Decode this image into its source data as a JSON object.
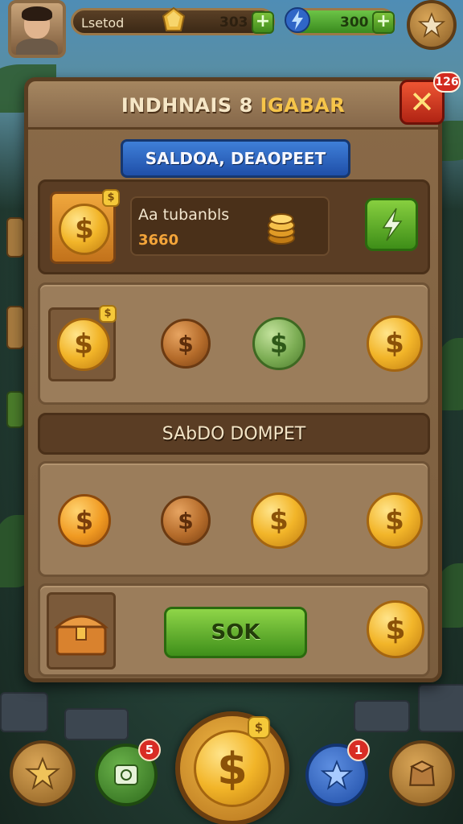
{
  "top_bar": {
    "resource_1": {
      "label": "Lsetod",
      "value": "303"
    },
    "resource_2": {
      "value": "300"
    },
    "plus_label": "+"
  },
  "panel": {
    "title_part1": "INDHNAIS 8 ",
    "title_part2": "IGABAR",
    "close_label": "✕",
    "close_badge": "126",
    "blue_tab_label": "SALDOA, DEAOPEET",
    "info_label": "Aa tubanbls",
    "info_value": "3660",
    "card_badge": "$",
    "section_title": "SAbDO DOMPET",
    "ok_label": "SOK"
  },
  "coin_symbol": "$",
  "bottom_nav": {
    "badge_left": "5",
    "badge_right": "1"
  },
  "colors": {
    "panel_bg": "#7a5d3e",
    "accent_blue": "#2e64c0",
    "accent_green": "#5aa82a",
    "close_red": "#d0361e",
    "gold": "#f2b529"
  }
}
